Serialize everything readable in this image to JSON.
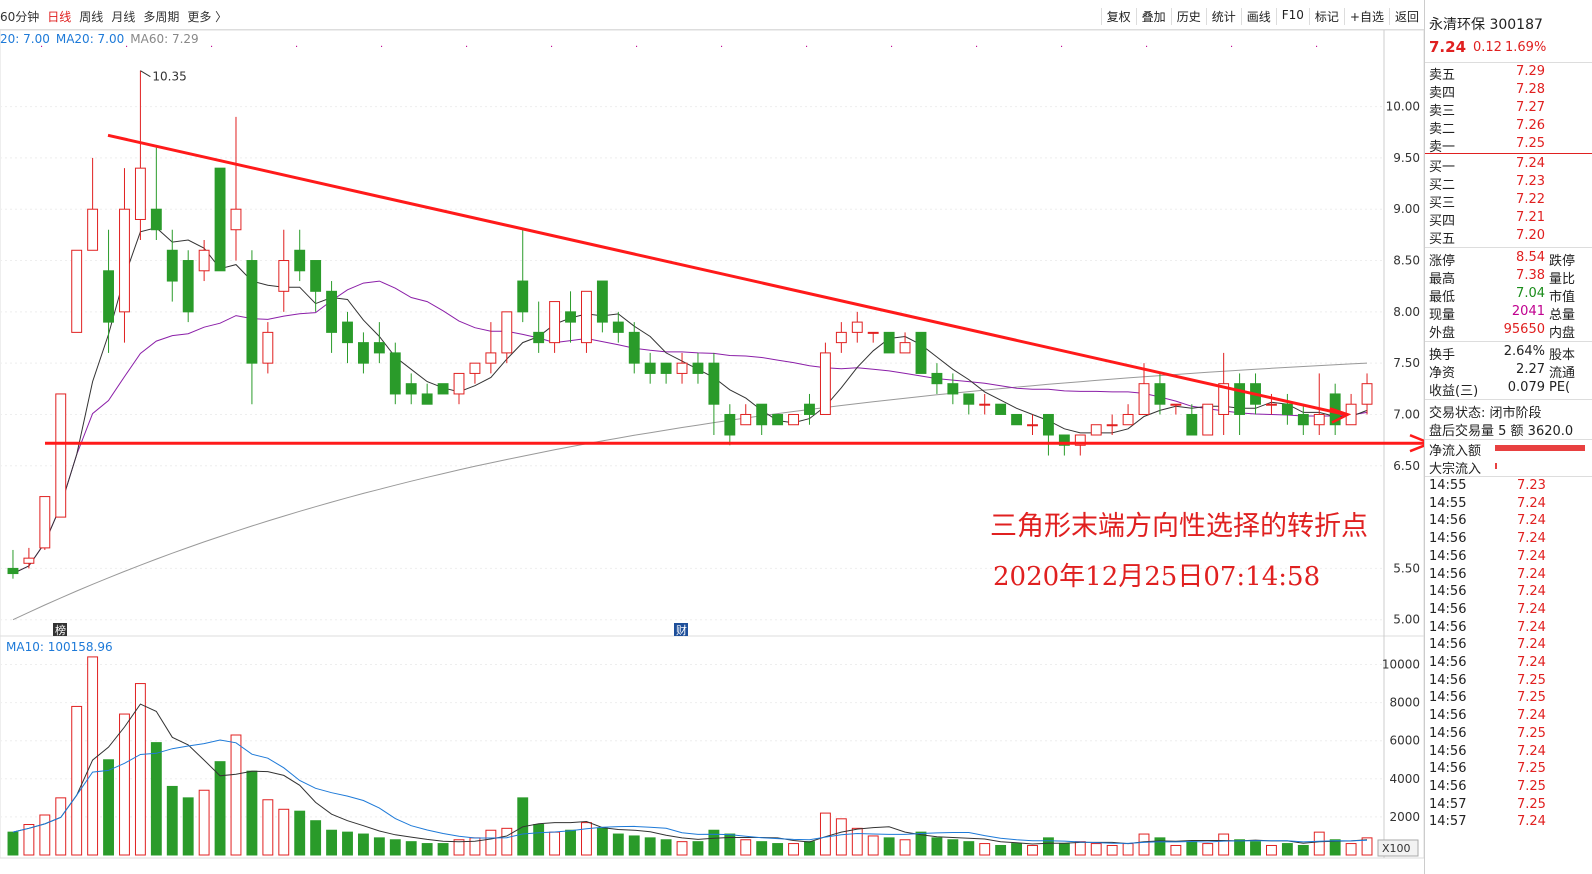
{
  "toolbar": {
    "left_tabs": [
      "60分钟",
      "日线",
      "周线",
      "月线",
      "多周期",
      "更多 〉"
    ],
    "active_tab": "日线",
    "right_buttons": [
      "复权",
      "叠加",
      "历史",
      "统计",
      "画线",
      "F10",
      "标记",
      "+自选",
      "返回"
    ]
  },
  "ma_legend": [
    {
      "label": "20: 7.00",
      "color": "#1e7ad8"
    },
    {
      "label": "MA20: 7.00",
      "color": "#1e7ad8"
    },
    {
      "label": "MA60: 7.29",
      "color": "#888888"
    }
  ],
  "vol_legend": "MA10: 100158.96",
  "annotations": {
    "line1": "三角形末端方向性选择的转折点",
    "line2": "2020年12月25日07:14:58",
    "high_label": "10.35",
    "marker1": "榜",
    "marker2": "财",
    "x100": "X100"
  },
  "side": {
    "title": "永清环保 300187",
    "price": "7.24",
    "change": "0.12",
    "pct": "1.69%",
    "asks": [
      {
        "label": "卖五",
        "price": "7.29"
      },
      {
        "label": "卖四",
        "price": "7.28"
      },
      {
        "label": "卖三",
        "price": "7.27"
      },
      {
        "label": "卖二",
        "price": "7.26"
      },
      {
        "label": "卖一",
        "price": "7.25"
      }
    ],
    "bids": [
      {
        "label": "买一",
        "price": "7.24"
      },
      {
        "label": "买二",
        "price": "7.23"
      },
      {
        "label": "买三",
        "price": "7.22"
      },
      {
        "label": "买四",
        "price": "7.21"
      },
      {
        "label": "买五",
        "price": "7.20"
      }
    ],
    "stats1": [
      {
        "label": "涨停",
        "value": "8.54",
        "cls": "red",
        "extra": "跌停"
      },
      {
        "label": "最高",
        "value": "7.38",
        "cls": "red",
        "extra": "量比"
      },
      {
        "label": "最低",
        "value": "7.04",
        "cls": "green",
        "extra": "市值"
      },
      {
        "label": "现量",
        "value": "2041",
        "cls": "purple",
        "extra": "总量"
      },
      {
        "label": "外盘",
        "value": "95650",
        "cls": "red",
        "extra": "内盘"
      }
    ],
    "stats2": [
      {
        "label": "换手",
        "value": "2.64%",
        "extra": "股本"
      },
      {
        "label": "净资",
        "value": "2.27",
        "extra": "流通"
      },
      {
        "label": "收益(三)",
        "value": "0.079",
        "extra": "PE("
      }
    ],
    "trade_status": "交易状态: 闭市阶段",
    "after_hours": "盘后交易量 5 额 3620.0",
    "net_inflow": "净流入额",
    "block_inflow": "大宗流入",
    "ticks": [
      {
        "t": "14:55",
        "p": "7.23"
      },
      {
        "t": "14:55",
        "p": "7.24"
      },
      {
        "t": "14:56",
        "p": "7.24"
      },
      {
        "t": "14:56",
        "p": "7.24"
      },
      {
        "t": "14:56",
        "p": "7.24"
      },
      {
        "t": "14:56",
        "p": "7.24"
      },
      {
        "t": "14:56",
        "p": "7.24"
      },
      {
        "t": "14:56",
        "p": "7.24"
      },
      {
        "t": "14:56",
        "p": "7.24"
      },
      {
        "t": "14:56",
        "p": "7.24"
      },
      {
        "t": "14:56",
        "p": "7.24"
      },
      {
        "t": "14:56",
        "p": "7.25"
      },
      {
        "t": "14:56",
        "p": "7.25"
      },
      {
        "t": "14:56",
        "p": "7.24"
      },
      {
        "t": "14:56",
        "p": "7.25"
      },
      {
        "t": "14:56",
        "p": "7.24"
      },
      {
        "t": "14:56",
        "p": "7.25"
      },
      {
        "t": "14:56",
        "p": "7.25"
      },
      {
        "t": "14:57",
        "p": "7.25"
      },
      {
        "t": "14:57",
        "p": "7.24"
      }
    ]
  },
  "chart_data": {
    "type": "candlestick",
    "price_axis": {
      "ticks": [
        "10.00",
        "9.50",
        "9.00",
        "8.50",
        "8.00",
        "7.50",
        "7.00",
        "6.50",
        "5.50",
        "5.00"
      ],
      "ylim": [
        4.9,
        10.6
      ]
    },
    "volume_axis": {
      "ticks": [
        "10000",
        "8000",
        "6000",
        "4000",
        "2000"
      ],
      "ylim": [
        0,
        10500
      ]
    },
    "colors": {
      "up": "#e02020",
      "down": "#2a9b2a",
      "ma5": "#333333",
      "ma10": "#8b1fa8",
      "ma60": "#999999",
      "trend": "#ff1a1a"
    },
    "candles": [
      [
        5.5,
        5.68,
        5.45,
        5.4,
        1200
      ],
      [
        5.55,
        5.7,
        5.6,
        5.5,
        1600
      ],
      [
        5.7,
        6.2,
        6.2,
        5.68,
        2100
      ],
      [
        6.0,
        7.2,
        7.2,
        6.0,
        3000
      ],
      [
        7.8,
        8.6,
        8.6,
        7.8,
        7800
      ],
      [
        8.6,
        9.5,
        9.0,
        8.6,
        10400
      ],
      [
        8.4,
        8.8,
        7.9,
        7.6,
        5000
      ],
      [
        8.0,
        9.4,
        9.0,
        7.7,
        7400
      ],
      [
        8.9,
        10.35,
        9.4,
        8.7,
        9000
      ],
      [
        9.0,
        9.6,
        8.8,
        8.7,
        5900
      ],
      [
        8.6,
        8.8,
        8.3,
        8.1,
        3600
      ],
      [
        8.5,
        8.6,
        8.0,
        7.9,
        3000
      ],
      [
        8.4,
        8.7,
        8.6,
        8.3,
        3400
      ],
      [
        9.4,
        9.4,
        8.4,
        8.4,
        4900
      ],
      [
        8.8,
        9.9,
        9.0,
        8.5,
        6300
      ],
      [
        8.5,
        8.6,
        7.5,
        7.1,
        4400
      ],
      [
        7.5,
        7.9,
        7.8,
        7.4,
        2900
      ],
      [
        8.2,
        8.8,
        8.5,
        8.0,
        2400
      ],
      [
        8.6,
        8.8,
        8.4,
        8.3,
        2300
      ],
      [
        8.5,
        8.5,
        8.2,
        8.0,
        1800
      ],
      [
        8.2,
        8.3,
        7.8,
        7.6,
        1300
      ],
      [
        7.9,
        8.0,
        7.7,
        7.5,
        1200
      ],
      [
        7.7,
        7.8,
        7.5,
        7.4,
        1100
      ],
      [
        7.7,
        7.9,
        7.6,
        7.5,
        900
      ],
      [
        7.6,
        7.7,
        7.2,
        7.1,
        800
      ],
      [
        7.3,
        7.4,
        7.2,
        7.1,
        700
      ],
      [
        7.2,
        7.3,
        7.1,
        7.1,
        600
      ],
      [
        7.3,
        7.3,
        7.2,
        7.2,
        600
      ],
      [
        7.2,
        7.4,
        7.4,
        7.1,
        800
      ],
      [
        7.4,
        7.5,
        7.5,
        7.3,
        900
      ],
      [
        7.5,
        7.9,
        7.6,
        7.4,
        1300
      ],
      [
        7.6,
        8.0,
        8.0,
        7.5,
        1400
      ],
      [
        8.3,
        8.8,
        8.0,
        7.9,
        3000
      ],
      [
        7.8,
        8.1,
        7.7,
        7.6,
        1600
      ],
      [
        7.7,
        8.1,
        8.1,
        7.6,
        1200
      ],
      [
        8.0,
        8.2,
        7.9,
        7.7,
        1300
      ],
      [
        7.7,
        8.2,
        8.2,
        7.6,
        1700
      ],
      [
        8.3,
        8.3,
        7.9,
        7.8,
        1400
      ],
      [
        7.9,
        8.0,
        7.8,
        7.7,
        1100
      ],
      [
        7.8,
        7.9,
        7.5,
        7.4,
        1000
      ],
      [
        7.5,
        7.6,
        7.4,
        7.3,
        900
      ],
      [
        7.5,
        7.5,
        7.4,
        7.3,
        800
      ],
      [
        7.4,
        7.6,
        7.5,
        7.3,
        700
      ],
      [
        7.5,
        7.6,
        7.4,
        7.3,
        700
      ],
      [
        7.5,
        7.6,
        7.1,
        6.8,
        1300
      ],
      [
        7.0,
        7.1,
        6.8,
        6.7,
        1100
      ],
      [
        6.9,
        7.1,
        7.0,
        6.9,
        800
      ],
      [
        7.1,
        7.1,
        6.9,
        6.8,
        700
      ],
      [
        7.0,
        7.0,
        6.9,
        6.9,
        600
      ],
      [
        6.9,
        7.0,
        7.0,
        6.9,
        600
      ],
      [
        7.1,
        7.2,
        7.0,
        6.9,
        700
      ],
      [
        7.0,
        7.7,
        7.6,
        7.0,
        2200
      ],
      [
        7.7,
        7.9,
        7.8,
        7.6,
        1900
      ],
      [
        7.8,
        8.0,
        7.9,
        7.7,
        1400
      ],
      [
        7.8,
        7.8,
        7.8,
        7.7,
        1000
      ],
      [
        7.8,
        7.8,
        7.6,
        7.6,
        900
      ],
      [
        7.6,
        7.8,
        7.7,
        7.6,
        800
      ],
      [
        7.8,
        7.8,
        7.4,
        7.4,
        1200
      ],
      [
        7.4,
        7.5,
        7.3,
        7.2,
        900
      ],
      [
        7.3,
        7.4,
        7.2,
        7.1,
        800
      ],
      [
        7.2,
        7.2,
        7.1,
        7.0,
        700
      ],
      [
        7.1,
        7.2,
        7.1,
        7.0,
        600
      ],
      [
        7.1,
        7.1,
        7.0,
        7.0,
        500
      ],
      [
        7.0,
        7.0,
        6.9,
        6.9,
        600
      ],
      [
        6.9,
        7.0,
        6.9,
        6.8,
        500
      ],
      [
        7.0,
        7.0,
        6.8,
        6.6,
        900
      ],
      [
        6.8,
        6.8,
        6.7,
        6.6,
        600
      ],
      [
        6.7,
        6.8,
        6.8,
        6.6,
        700
      ],
      [
        6.8,
        6.9,
        6.9,
        6.8,
        600
      ],
      [
        6.9,
        7.0,
        6.9,
        6.8,
        500
      ],
      [
        6.9,
        7.1,
        7.0,
        6.9,
        600
      ],
      [
        7.0,
        7.5,
        7.3,
        7.0,
        1100
      ],
      [
        7.3,
        7.4,
        7.1,
        7.0,
        900
      ],
      [
        7.1,
        7.1,
        7.1,
        7.0,
        500
      ],
      [
        7.0,
        7.1,
        6.8,
        6.8,
        700
      ],
      [
        6.8,
        7.1,
        7.1,
        6.8,
        600
      ],
      [
        7.0,
        7.6,
        7.3,
        6.8,
        1100
      ],
      [
        7.3,
        7.4,
        7.0,
        6.8,
        800
      ],
      [
        7.3,
        7.4,
        7.1,
        7.0,
        700
      ],
      [
        7.1,
        7.2,
        7.1,
        7.0,
        500
      ],
      [
        7.1,
        7.2,
        7.0,
        6.9,
        600
      ],
      [
        7.0,
        7.1,
        6.9,
        6.8,
        500
      ],
      [
        6.9,
        7.4,
        7.0,
        6.8,
        1200
      ],
      [
        7.2,
        7.3,
        6.9,
        6.8,
        800
      ],
      [
        6.9,
        7.2,
        7.1,
        6.9,
        600
      ],
      [
        7.1,
        7.4,
        7.3,
        7.0,
        900
      ]
    ]
  }
}
